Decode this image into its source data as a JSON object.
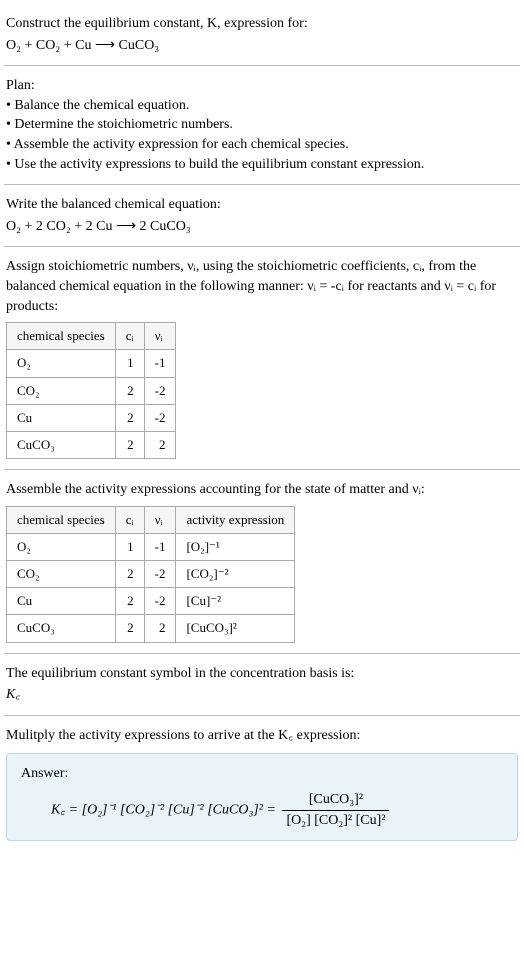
{
  "header": {
    "line1": "Construct the equilibrium constant, K, expression for:",
    "equation": "O₂ + CO₂ + Cu ⟶ CuCO₃"
  },
  "plan": {
    "title": "Plan:",
    "bullets": [
      "• Balance the chemical equation.",
      "• Determine the stoichiometric numbers.",
      "• Assemble the activity expression for each chemical species.",
      "• Use the activity expressions to build the equilibrium constant expression."
    ]
  },
  "balanced": {
    "title": "Write the balanced chemical equation:",
    "equation": "O₂ + 2 CO₂ + 2 Cu ⟶ 2 CuCO₃"
  },
  "stoich": {
    "text": "Assign stoichiometric numbers, νᵢ, using the stoichiometric coefficients, cᵢ, from the balanced chemical equation in the following manner: νᵢ = -cᵢ for reactants and νᵢ = cᵢ for products:",
    "headers": [
      "chemical species",
      "cᵢ",
      "νᵢ"
    ],
    "rows": [
      [
        "O₂",
        "1",
        "-1"
      ],
      [
        "CO₂",
        "2",
        "-2"
      ],
      [
        "Cu",
        "2",
        "-2"
      ],
      [
        "CuCO₃",
        "2",
        "2"
      ]
    ]
  },
  "activity": {
    "title": "Assemble the activity expressions accounting for the state of matter and νᵢ:",
    "headers": [
      "chemical species",
      "cᵢ",
      "νᵢ",
      "activity expression"
    ],
    "rows": [
      [
        "O₂",
        "1",
        "-1",
        "[O₂]⁻¹"
      ],
      [
        "CO₂",
        "2",
        "-2",
        "[CO₂]⁻²"
      ],
      [
        "Cu",
        "2",
        "-2",
        "[Cu]⁻²"
      ],
      [
        "CuCO₃",
        "2",
        "2",
        "[CuCO₃]²"
      ]
    ]
  },
  "symbol": {
    "title": "The equilibrium constant symbol in the concentration basis is:",
    "value": "K꜀"
  },
  "multiply": {
    "title": "Mulitply the activity expressions to arrive at the K꜀ expression:"
  },
  "answer": {
    "label": "Answer:",
    "lhs": "K꜀ = [O₂]⁻¹ [CO₂]⁻² [Cu]⁻² [CuCO₃]² = ",
    "frac_num": "[CuCO₃]²",
    "frac_den": "[O₂] [CO₂]² [Cu]²"
  },
  "chart_data": {
    "type": "table",
    "tables": [
      {
        "title": "Stoichiometric numbers",
        "columns": [
          "chemical species",
          "cᵢ",
          "νᵢ"
        ],
        "rows": [
          {
            "chemical species": "O₂",
            "cᵢ": 1,
            "νᵢ": -1
          },
          {
            "chemical species": "CO₂",
            "cᵢ": 2,
            "νᵢ": -2
          },
          {
            "chemical species": "Cu",
            "cᵢ": 2,
            "νᵢ": -2
          },
          {
            "chemical species": "CuCO₃",
            "cᵢ": 2,
            "νᵢ": 2
          }
        ]
      },
      {
        "title": "Activity expressions",
        "columns": [
          "chemical species",
          "cᵢ",
          "νᵢ",
          "activity expression"
        ],
        "rows": [
          {
            "chemical species": "O₂",
            "cᵢ": 1,
            "νᵢ": -1,
            "activity expression": "[O₂]^-1"
          },
          {
            "chemical species": "CO₂",
            "cᵢ": 2,
            "νᵢ": -2,
            "activity expression": "[CO₂]^-2"
          },
          {
            "chemical species": "Cu",
            "cᵢ": 2,
            "νᵢ": -2,
            "activity expression": "[Cu]^-2"
          },
          {
            "chemical species": "CuCO₃",
            "cᵢ": 2,
            "νᵢ": 2,
            "activity expression": "[CuCO₃]^2"
          }
        ]
      }
    ]
  }
}
